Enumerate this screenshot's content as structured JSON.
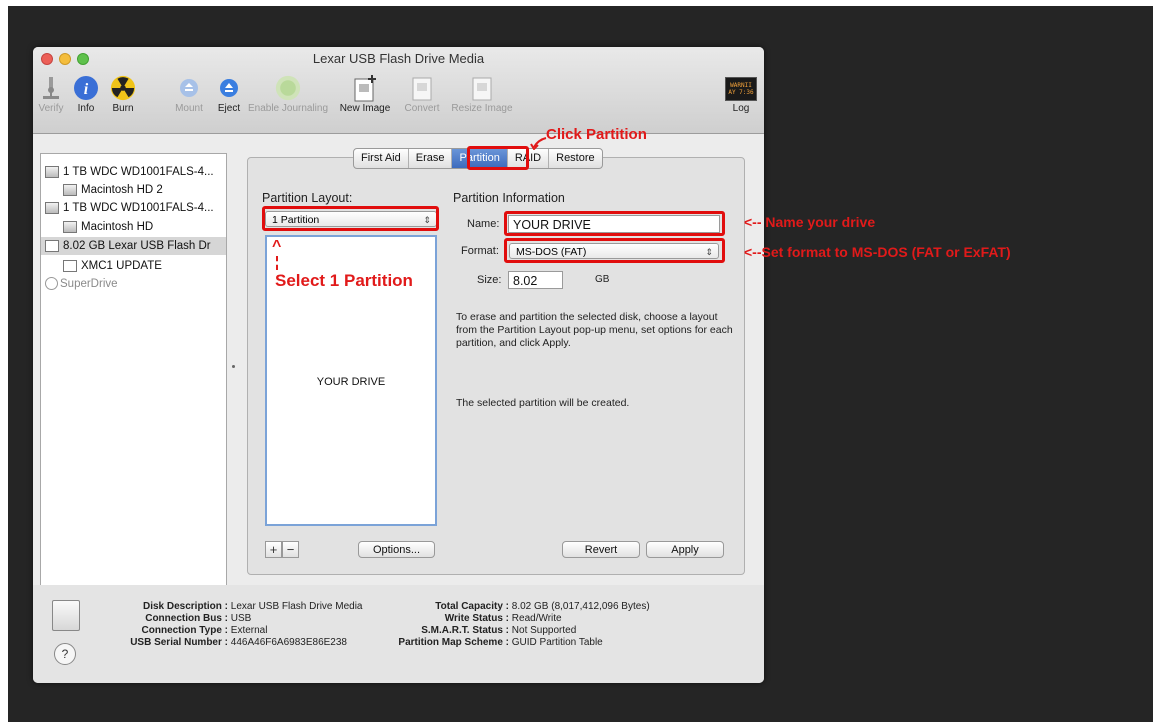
{
  "window": {
    "title": "Lexar USB Flash Drive Media"
  },
  "toolbar": {
    "items": [
      {
        "label": "Verify",
        "icon": "microscope-icon",
        "enabled": false
      },
      {
        "label": "Info",
        "icon": "info-icon",
        "enabled": true
      },
      {
        "label": "Burn",
        "icon": "radiation-icon",
        "enabled": true
      },
      {
        "label": "Mount",
        "icon": "mount-icon",
        "enabled": false
      },
      {
        "label": "Eject",
        "icon": "eject-icon",
        "enabled": true
      },
      {
        "label": "Enable Journaling",
        "icon": "journaling-icon",
        "enabled": false
      },
      {
        "label": "New Image",
        "icon": "new-image-icon",
        "enabled": true
      },
      {
        "label": "Convert",
        "icon": "convert-icon",
        "enabled": false
      },
      {
        "label": "Resize Image",
        "icon": "resize-image-icon",
        "enabled": false
      }
    ],
    "log": {
      "label": "Log",
      "screen_text": "WARNII\nAY 7:36"
    }
  },
  "sidebar": {
    "items": [
      {
        "label": "1 TB WDC WD1001FALS-4...",
        "level": 0
      },
      {
        "label": "Macintosh HD 2",
        "level": 1
      },
      {
        "label": "1 TB WDC WD1001FALS-4...",
        "level": 0
      },
      {
        "label": "Macintosh HD",
        "level": 1
      },
      {
        "label": "8.02 GB Lexar USB Flash Dr",
        "level": 0,
        "selected": true
      },
      {
        "label": "XMC1 UPDATE",
        "level": 1
      },
      {
        "label": "SuperDrive",
        "level": 0,
        "dim": true
      }
    ]
  },
  "tabs": [
    {
      "label": "First Aid",
      "active": false
    },
    {
      "label": "Erase",
      "active": false
    },
    {
      "label": "Partition",
      "active": true
    },
    {
      "label": "RAID",
      "active": false
    },
    {
      "label": "Restore",
      "active": false
    }
  ],
  "partition": {
    "layout_label": "Partition Layout:",
    "layout_value": "1 Partition",
    "layout_partition_name": "YOUR DRIVE",
    "info_label": "Partition Information",
    "name_label": "Name:",
    "name_value": "YOUR DRIVE",
    "format_label": "Format:",
    "format_value": "MS-DOS (FAT)",
    "size_label": "Size:",
    "size_value": "8.02",
    "size_unit": "GB",
    "help_text": "To erase and partition the selected disk, choose a layout from the Partition Layout pop-up menu, set options for each partition, and click Apply.",
    "status_text": "The selected partition will be created.",
    "add_label": "+",
    "remove_label": "−",
    "options_label": "Options...",
    "revert_label": "Revert",
    "apply_label": "Apply"
  },
  "disk_info": {
    "left": [
      {
        "key": "Disk Description :",
        "value": "Lexar USB Flash Drive Media"
      },
      {
        "key": "Connection Bus :",
        "value": "USB"
      },
      {
        "key": "Connection Type :",
        "value": "External"
      },
      {
        "key": "USB Serial Number :",
        "value": "446A46F6A6983E86E238"
      }
    ],
    "right": [
      {
        "key": "Total Capacity :",
        "value": "8.02 GB (8,017,412,096 Bytes)"
      },
      {
        "key": "Write Status :",
        "value": "Read/Write"
      },
      {
        "key": "S.M.A.R.T. Status :",
        "value": "Not Supported"
      },
      {
        "key": "Partition Map Scheme :",
        "value": "GUID Partition Table"
      }
    ],
    "help_label": "?"
  },
  "annotations": {
    "click_partition": "Click Partition",
    "select_partition": "Select 1 Partition",
    "name_drive": "<-- Name your drive",
    "set_format": "<--Set format to MS-DOS (FAT or ExFAT)",
    "up_arrow": "^",
    "color": "#e11a1a"
  }
}
